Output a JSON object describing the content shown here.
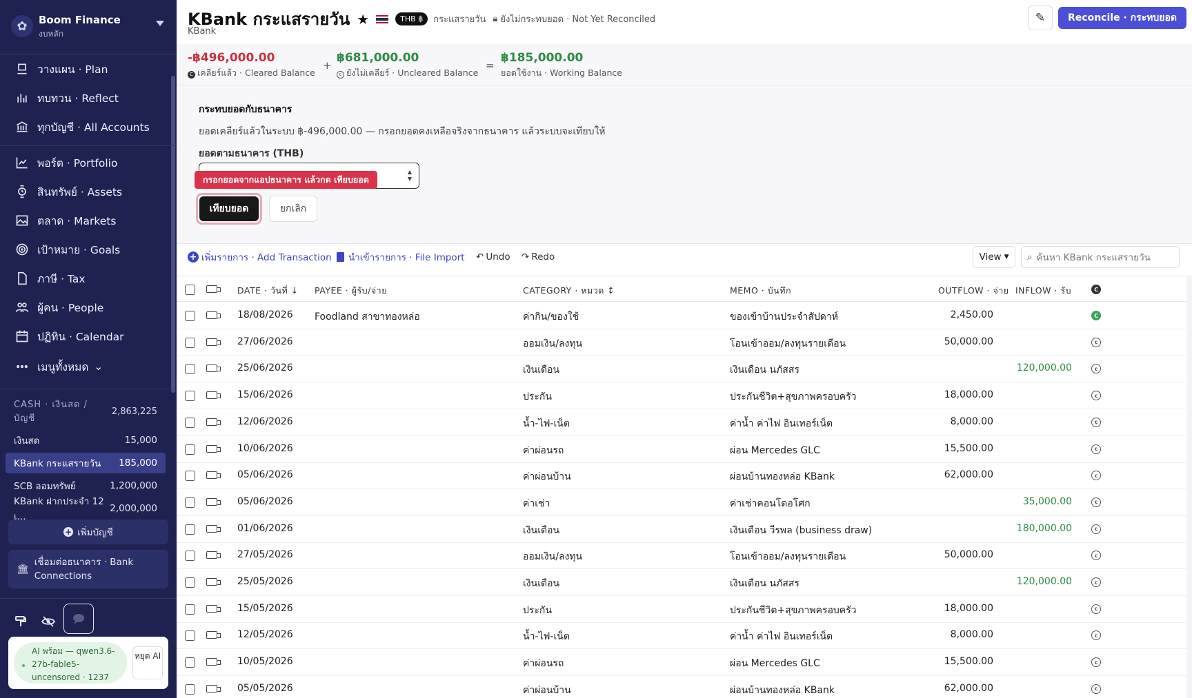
{
  "sidebar": {
    "brand_name": "Boom Finance",
    "brand_sub": "งบหลัก",
    "nav": [
      {
        "label": "วางแผน · Plan",
        "icon": "plan-icon"
      },
      {
        "label": "ทบทวน · Reflect",
        "icon": "chart-icon"
      },
      {
        "label": "ทุกบัญชี · All Accounts",
        "icon": "bank-icon"
      },
      {
        "label": "พอร์ต · Portfolio",
        "icon": "line-chart-icon"
      },
      {
        "label": "สินทรัพย์ · Assets",
        "icon": "watch-icon"
      },
      {
        "label": "ตลาด · Markets",
        "icon": "image-icon"
      },
      {
        "label": "เป้าหมาย · Goals",
        "icon": "target-icon"
      },
      {
        "label": "ภาษี · Tax",
        "icon": "document-icon"
      },
      {
        "label": "ผู้คน · People",
        "icon": "people-icon"
      },
      {
        "label": "ปฏิทิน · Calendar",
        "icon": "calendar-icon"
      },
      {
        "label": "เมนูทั้งหมด",
        "icon": "more-icon"
      }
    ],
    "accounts_header": "CASH · เงินสด / บัญชี",
    "accounts_total": "2,863,225",
    "accounts": [
      {
        "name": "เงินสด",
        "value": "15,000"
      },
      {
        "name": "KBank กระแสรายวัน",
        "value": "185,000"
      },
      {
        "name": "SCB ออมทรัพย์",
        "value": "1,200,000"
      },
      {
        "name": "KBank ฝากประจำ 12 เ...",
        "value": "2,000,000"
      }
    ],
    "add_account": "เพิ่มบัญชี",
    "bank_connections": "เชื่อมต่อธนาคาร · Bank Connections",
    "ai_status": "AI พร้อม — qwen3.6-27b-fable5-uncensored · 1237",
    "ai_stop": "หยุด AI"
  },
  "header": {
    "title": "KBank กระแสรายวัน",
    "currency_badge": "THB ฿",
    "account_type": "กระแสรายวัน",
    "reconcile_status": "ยังไม่กระทบยอด · Not Yet Reconciled",
    "subtitle": "KBank",
    "reconcile_button": "Reconcile · กระทบยอด"
  },
  "balances": {
    "cleared_amount": "-฿496,000.00",
    "cleared_label": "เคลียร์แล้ว · Cleared Balance",
    "uncleared_amount": "฿681,000.00",
    "uncleared_label": "ยังไม่เคลียร์ · Uncleared Balance",
    "working_amount": "฿185,000.00",
    "working_label": "ยอดใช้งาน · Working Balance",
    "plus": "+",
    "equals": "=",
    "colors": {
      "negative": "#c8323e",
      "positive": "#2e8b45"
    }
  },
  "reconcile_panel": {
    "title": "กระทบยอดกับธนาคาร",
    "description": "ยอดเคลียร์แล้วในระบบ ฿-496,000.00 — กรอกยอดคงเหลือจริงจากธนาคาร แล้วระบบจะเทียบให้",
    "input_label": "ยอดตามธนาคาร (THB)",
    "input_value": "",
    "tooltip": "กรอกยอดจากแอปธนาคาร แล้วกด เทียบยอด",
    "compare_button": "เทียบยอด",
    "cancel_button": "ยกเลิก"
  },
  "toolbar": {
    "add_transaction": "เพิ่มรายการ · Add Transaction",
    "file_import": "นำเข้ารายการ · File Import",
    "undo": "Undo",
    "redo": "Redo",
    "view": "View",
    "search_placeholder": "ค้นหา KBank กระแสรายวัน"
  },
  "table": {
    "columns": {
      "date": "DATE · วันที่ ↓",
      "payee": "PAYEE · ผู้รับ/จ่าย",
      "category": "CATEGORY · หมวด ↕",
      "memo": "MEMO · บันทึก",
      "outflow": "OUTFLOW · จ่าย",
      "inflow": "INFLOW · รับ"
    },
    "rows": [
      {
        "date": "18/08/2026",
        "payee": "Foodland สาขาทองหล่อ",
        "category": "ค่ากิน/ของใช้",
        "memo": "ของเข้าบ้านประจำสัปดาห์",
        "outflow": "2,450.00",
        "inflow": "",
        "cleared": true
      },
      {
        "date": "27/06/2026",
        "payee": "",
        "category": "ออมเงิน/ลงทุน",
        "memo": "โอนเข้าออม/ลงทุนรายเดือน",
        "outflow": "50,000.00",
        "inflow": "",
        "cleared": false
      },
      {
        "date": "25/06/2026",
        "payee": "",
        "category": "เงินเดือน",
        "memo": "เงินเดือน นภัสสร",
        "outflow": "",
        "inflow": "120,000.00",
        "cleared": false
      },
      {
        "date": "15/06/2026",
        "payee": "",
        "category": "ประกัน",
        "memo": "ประกันชีวิต+สุขภาพครอบครัว",
        "outflow": "18,000.00",
        "inflow": "",
        "cleared": false
      },
      {
        "date": "12/06/2026",
        "payee": "",
        "category": "น้ำ-ไฟ-เน็ต",
        "memo": "ค่าน้ำ ค่าไฟ อินเทอร์เน็ต",
        "outflow": "8,000.00",
        "inflow": "",
        "cleared": false
      },
      {
        "date": "10/06/2026",
        "payee": "",
        "category": "ค่าผ่อนรถ",
        "memo": "ผ่อน Mercedes GLC",
        "outflow": "15,500.00",
        "inflow": "",
        "cleared": false
      },
      {
        "date": "05/06/2026",
        "payee": "",
        "category": "ค่าผ่อนบ้าน",
        "memo": "ผ่อนบ้านทองหล่อ KBank",
        "outflow": "62,000.00",
        "inflow": "",
        "cleared": false
      },
      {
        "date": "05/06/2026",
        "payee": "",
        "category": "ค่าเช่า",
        "memo": "ค่าเช่าคอนโดอโศก",
        "outflow": "",
        "inflow": "35,000.00",
        "cleared": false
      },
      {
        "date": "01/06/2026",
        "payee": "",
        "category": "เงินเดือน",
        "memo": "เงินเดือน วีรพล (business draw)",
        "outflow": "",
        "inflow": "180,000.00",
        "cleared": false
      },
      {
        "date": "27/05/2026",
        "payee": "",
        "category": "ออมเงิน/ลงทุน",
        "memo": "โอนเข้าออม/ลงทุนรายเดือน",
        "outflow": "50,000.00",
        "inflow": "",
        "cleared": false
      },
      {
        "date": "25/05/2026",
        "payee": "",
        "category": "เงินเดือน",
        "memo": "เงินเดือน นภัสสร",
        "outflow": "",
        "inflow": "120,000.00",
        "cleared": false
      },
      {
        "date": "15/05/2026",
        "payee": "",
        "category": "ประกัน",
        "memo": "ประกันชีวิต+สุขภาพครอบครัว",
        "outflow": "18,000.00",
        "inflow": "",
        "cleared": false
      },
      {
        "date": "12/05/2026",
        "payee": "",
        "category": "น้ำ-ไฟ-เน็ต",
        "memo": "ค่าน้ำ ค่าไฟ อินเทอร์เน็ต",
        "outflow": "8,000.00",
        "inflow": "",
        "cleared": false
      },
      {
        "date": "10/05/2026",
        "payee": "",
        "category": "ค่าผ่อนรถ",
        "memo": "ผ่อน Mercedes GLC",
        "outflow": "15,500.00",
        "inflow": "",
        "cleared": false
      },
      {
        "date": "05/05/2026",
        "payee": "",
        "category": "ค่าผ่อนบ้าน",
        "memo": "ผ่อนบ้านทองหล่อ KBank",
        "outflow": "62,000.00",
        "inflow": "",
        "cleared": false
      }
    ],
    "inflow_color": "#2e8b45"
  }
}
